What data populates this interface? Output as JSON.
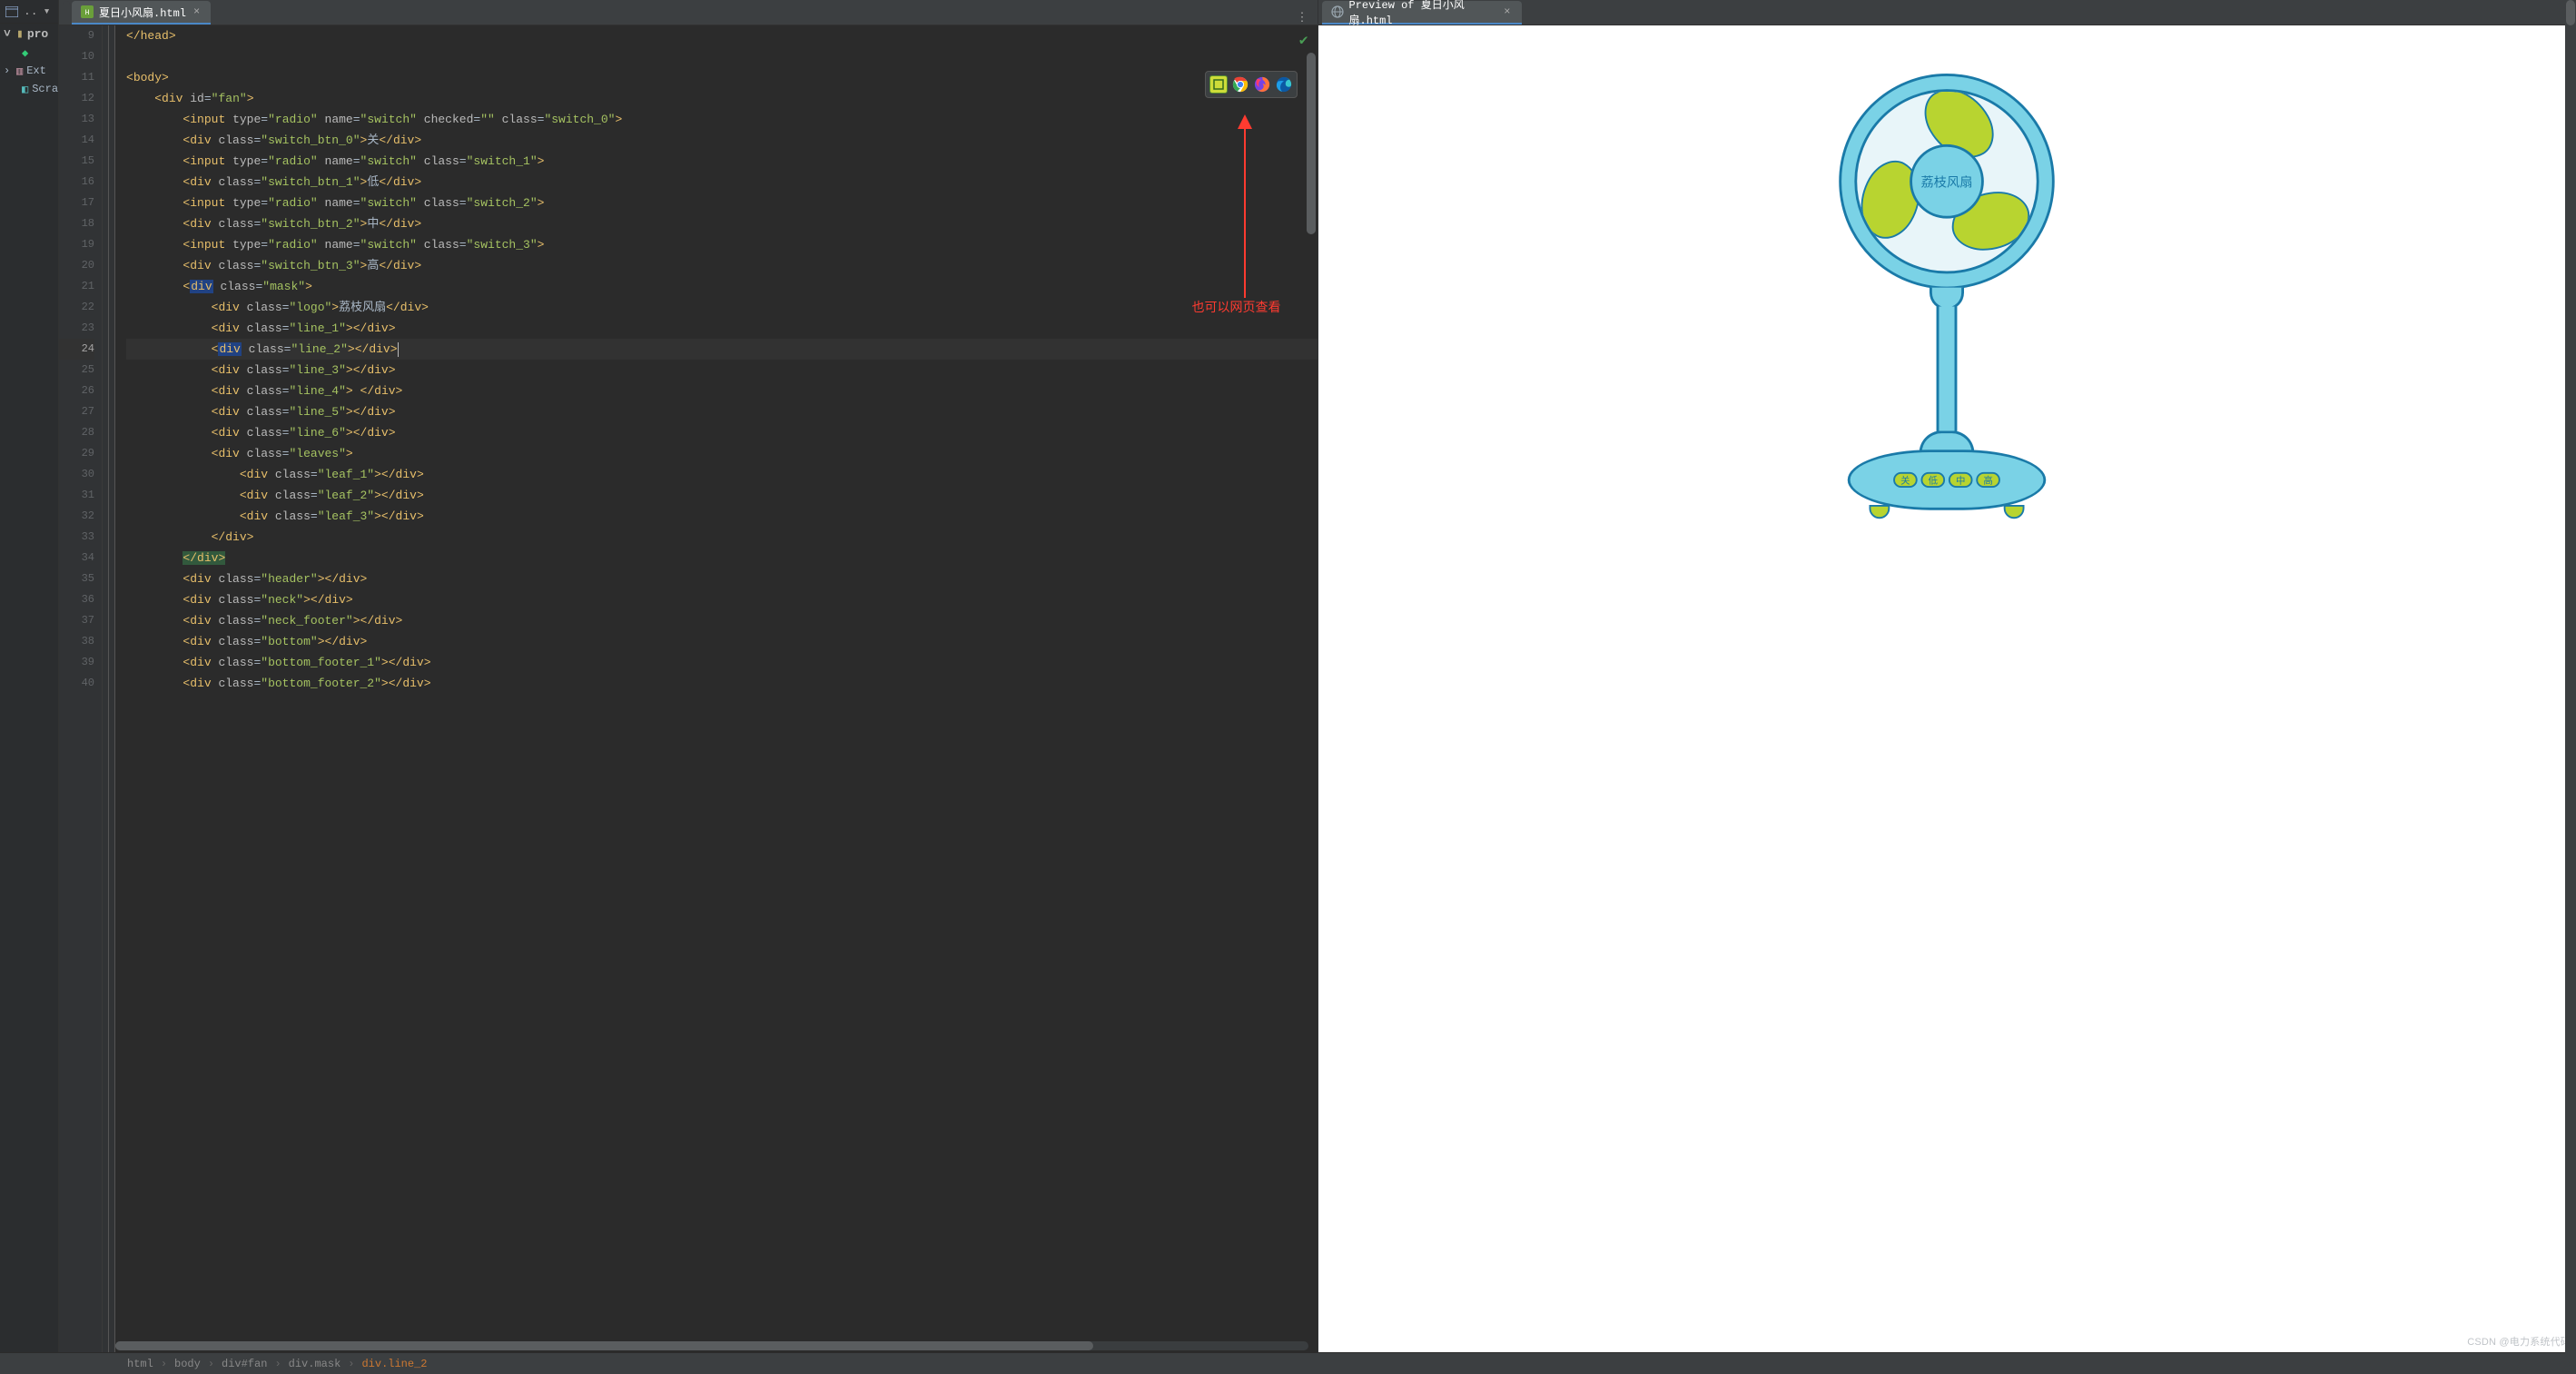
{
  "sidebar": {
    "folder": "pro",
    "items": [
      "",
      "Ext",
      "Scra"
    ]
  },
  "tabs": {
    "editor": {
      "filename": "夏日小风扇.html"
    },
    "preview": {
      "title": "Preview of 夏日小风扇.html"
    }
  },
  "gutter_start": 9,
  "gutter_end": 40,
  "highlight_line": 24,
  "code": {
    "l9": {
      "tag": "head"
    },
    "l11": {
      "tag": "body"
    },
    "l12": {
      "tag": "div",
      "attrs": [
        [
          "id",
          "fan"
        ]
      ]
    },
    "l13": {
      "tag": "input",
      "attrs": [
        [
          "type",
          "radio"
        ],
        [
          "name",
          "switch"
        ],
        [
          "checked",
          ""
        ],
        [
          "class",
          "switch_0"
        ]
      ]
    },
    "l14": {
      "tag": "div",
      "attrs": [
        [
          "class",
          "switch_btn_0"
        ]
      ],
      "text": "关"
    },
    "l15": {
      "tag": "input",
      "attrs": [
        [
          "type",
          "radio"
        ],
        [
          "name",
          "switch"
        ],
        [
          "class",
          "switch_1"
        ]
      ]
    },
    "l16": {
      "tag": "div",
      "attrs": [
        [
          "class",
          "switch_btn_1"
        ]
      ],
      "text": "低"
    },
    "l17": {
      "tag": "input",
      "attrs": [
        [
          "type",
          "radio"
        ],
        [
          "name",
          "switch"
        ],
        [
          "class",
          "switch_2"
        ]
      ]
    },
    "l18": {
      "tag": "div",
      "attrs": [
        [
          "class",
          "switch_btn_2"
        ]
      ],
      "text": "中"
    },
    "l19": {
      "tag": "input",
      "attrs": [
        [
          "type",
          "radio"
        ],
        [
          "name",
          "switch"
        ],
        [
          "class",
          "switch_3"
        ]
      ]
    },
    "l20": {
      "tag": "div",
      "attrs": [
        [
          "class",
          "switch_btn_3"
        ]
      ],
      "text": "高"
    },
    "l21": {
      "tag": "div",
      "attrs": [
        [
          "class",
          "mask"
        ]
      ],
      "hl_tag": true
    },
    "l22": {
      "tag": "div",
      "attrs": [
        [
          "class",
          "logo"
        ]
      ],
      "text": "荔枝风扇"
    },
    "l23": {
      "tag": "div",
      "attrs": [
        [
          "class",
          "line_1"
        ]
      ]
    },
    "l24": {
      "tag": "div",
      "attrs": [
        [
          "class",
          "line_2"
        ]
      ],
      "hl_tag": true
    },
    "l25": {
      "tag": "div",
      "attrs": [
        [
          "class",
          "line_3"
        ]
      ]
    },
    "l26": {
      "tag": "div",
      "attrs": [
        [
          "class",
          "line_4"
        ]
      ],
      "space_text": true
    },
    "l27": {
      "tag": "div",
      "attrs": [
        [
          "class",
          "line_5"
        ]
      ]
    },
    "l28": {
      "tag": "div",
      "attrs": [
        [
          "class",
          "line_6"
        ]
      ]
    },
    "l29": {
      "tag": "div",
      "attrs": [
        [
          "class",
          "leaves"
        ]
      ]
    },
    "l30": {
      "tag": "div",
      "attrs": [
        [
          "class",
          "leaf_1"
        ]
      ]
    },
    "l31": {
      "tag": "div",
      "attrs": [
        [
          "class",
          "leaf_2"
        ]
      ]
    },
    "l32": {
      "tag": "div",
      "attrs": [
        [
          "class",
          "leaf_3"
        ]
      ]
    },
    "l33": {
      "close": "div"
    },
    "l34": {
      "close": "div"
    },
    "l35": {
      "tag": "div",
      "attrs": [
        [
          "class",
          "header"
        ]
      ]
    },
    "l36": {
      "tag": "div",
      "attrs": [
        [
          "class",
          "neck"
        ]
      ]
    },
    "l37": {
      "tag": "div",
      "attrs": [
        [
          "class",
          "neck_footer"
        ]
      ]
    },
    "l38": {
      "tag": "div",
      "attrs": [
        [
          "class",
          "bottom"
        ]
      ]
    },
    "l39": {
      "tag": "div",
      "attrs": [
        [
          "class",
          "bottom_footer_1"
        ]
      ]
    },
    "l40": {
      "tag": "div",
      "attrs": [
        [
          "class",
          "bottom_footer_2"
        ]
      ]
    }
  },
  "annotation": "也可以网页查看",
  "breadcrumbs": [
    "html",
    "body",
    "div#fan",
    "div.mask",
    "div.line_2"
  ],
  "fan": {
    "logo": "荔枝风扇",
    "buttons": [
      "关",
      "低",
      "中",
      "高"
    ]
  },
  "watermark": "CSDN @电力系统代码"
}
